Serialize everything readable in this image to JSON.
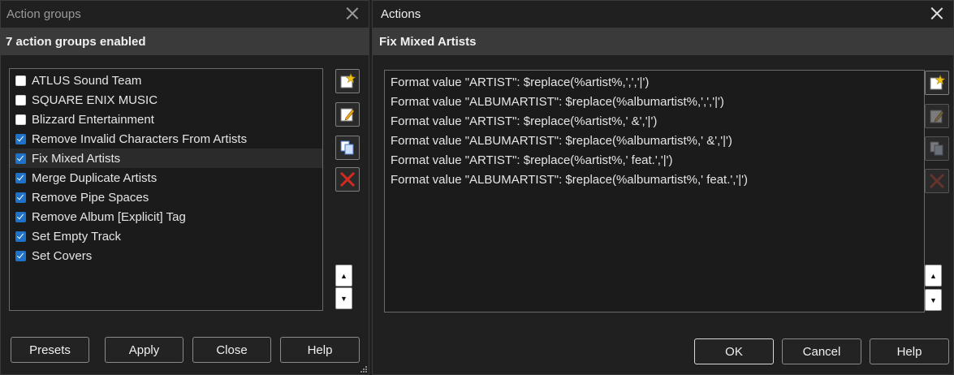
{
  "left": {
    "title": "Action groups",
    "header": "7 action groups enabled",
    "groups": [
      {
        "label": "ATLUS Sound Team",
        "checked": false
      },
      {
        "label": "SQUARE ENIX MUSIC",
        "checked": false
      },
      {
        "label": "Blizzard Entertainment",
        "checked": false
      },
      {
        "label": "Remove Invalid Characters From Artists",
        "checked": true
      },
      {
        "label": "Fix Mixed Artists",
        "checked": true,
        "selected": true
      },
      {
        "label": "Merge Duplicate Artists",
        "checked": true
      },
      {
        "label": "Remove Pipe Spaces",
        "checked": true
      },
      {
        "label": "Remove Album [Explicit] Tag",
        "checked": true
      },
      {
        "label": "Set Empty Track",
        "checked": true
      },
      {
        "label": "Set Covers",
        "checked": true
      }
    ],
    "buttons": {
      "presets": "Presets",
      "apply": "Apply",
      "close": "Close",
      "help": "Help"
    }
  },
  "right": {
    "title": "Actions",
    "header": "Fix Mixed Artists",
    "actions": [
      "Format value \"ARTIST\": $replace(%artist%,',','|')",
      "Format value \"ALBUMARTIST\": $replace(%albumartist%,',','|')",
      "Format value \"ARTIST\": $replace(%artist%,' &','|')",
      "Format value \"ALBUMARTIST\": $replace(%albumartist%,' &','|')",
      "Format value \"ARTIST\": $replace(%artist%,' feat.','|')",
      "Format value \"ALBUMARTIST\": $replace(%albumartist%,' feat.','|')"
    ],
    "buttons": {
      "ok": "OK",
      "cancel": "Cancel",
      "help": "Help"
    }
  },
  "icons": {
    "add": "add-star-icon",
    "edit": "edit-pencil-icon",
    "copy": "copy-icon",
    "delete": "delete-x-icon",
    "up": "arrow-up-icon",
    "down": "arrow-down-icon"
  },
  "colors": {
    "checkbox_on": "#1e73c8",
    "header_band": "#3a3a3a",
    "delete_red": "#d62a1e"
  }
}
